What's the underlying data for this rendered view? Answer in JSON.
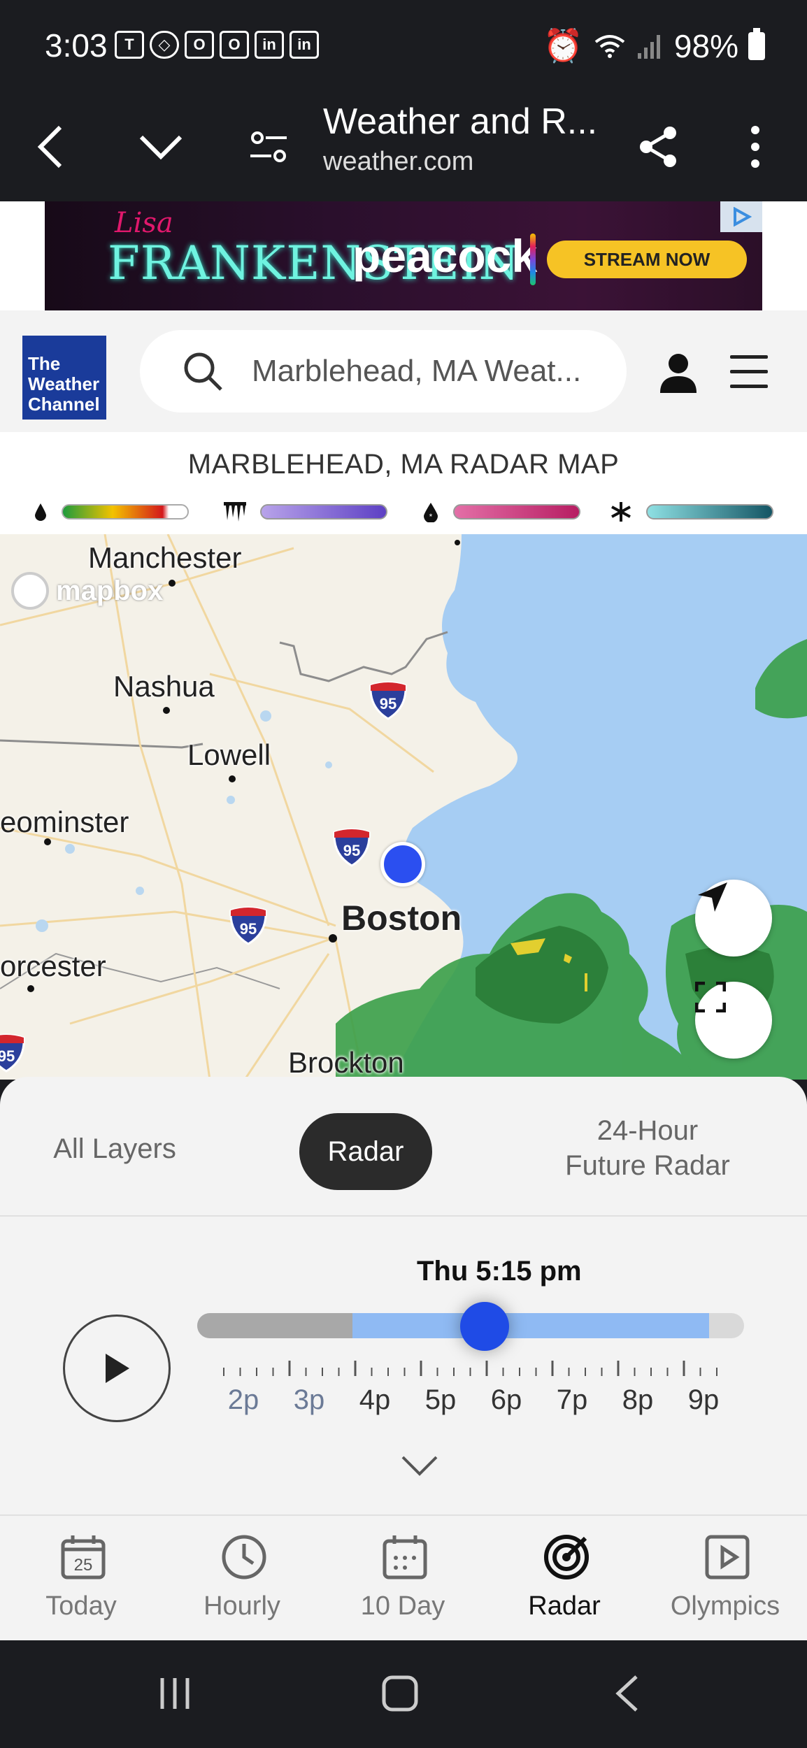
{
  "status_bar": {
    "time": "3:03",
    "battery": "98%",
    "left_icons": [
      "teams-icon",
      "copilot-icon",
      "office-icon",
      "outlook-icon",
      "linkedin-icon",
      "linkedin-icon"
    ],
    "right_icons": [
      "alarm-icon",
      "wifi-icon",
      "signal-icon",
      "battery-icon"
    ]
  },
  "browser": {
    "title": "Weather and R...",
    "url": "weather.com"
  },
  "ad": {
    "script_text": "Lisa",
    "title": "FRANKENSTEIN",
    "brand": "peacock",
    "cta": "STREAM NOW"
  },
  "header": {
    "logo_text": [
      "The",
      "Weather",
      "Channel"
    ],
    "search_placeholder": "Marblehead, MA Weat..."
  },
  "radar": {
    "title": "MARBLEHEAD, MA RADAR MAP",
    "legend": [
      {
        "icon": "rain-drop-icon",
        "gradient": [
          "#1e9b3c",
          "#f3c200",
          "#d3181b",
          "#ffffff"
        ]
      },
      {
        "icon": "ice-icon",
        "gradient": [
          "#b8a3ea",
          "#5d40c4"
        ]
      },
      {
        "icon": "mix-icon",
        "gradient": [
          "#e36fa7",
          "#b71d62"
        ]
      },
      {
        "icon": "snowflake-icon",
        "gradient": [
          "#8ee0e3",
          "#145564"
        ]
      }
    ]
  },
  "map": {
    "attribution": "mapbox",
    "labels": [
      "Manchester",
      "Nashua",
      "Lowell",
      "eominster",
      "Boston",
      "orcester",
      "Brockton"
    ],
    "highway": "95",
    "partial_highway": "95"
  },
  "layers": {
    "tabs": [
      "All Layers",
      "Radar",
      "24-Hour\nFuture Radar"
    ],
    "active": "Radar"
  },
  "timeline": {
    "current_time": "Thu 5:15 pm",
    "hours": [
      "2p",
      "3p",
      "4p",
      "5p",
      "6p",
      "7p",
      "8p",
      "9p"
    ],
    "progress_fraction": 0.56
  },
  "nav": {
    "items": [
      {
        "label": "Today",
        "icon": "calendar-day-icon",
        "badge": "25"
      },
      {
        "label": "Hourly",
        "icon": "clock-icon"
      },
      {
        "label": "10 Day",
        "icon": "calendar-icon"
      },
      {
        "label": "Radar",
        "icon": "radar-icon"
      },
      {
        "label": "Olympics",
        "icon": "play-icon"
      }
    ],
    "active": "Radar"
  },
  "colors": {
    "accent": "#1f4be6",
    "logo_blue": "#1a3b9a",
    "water": "#a6cdf3",
    "land": "#f4f1e8",
    "radar_green": "#3a9f48"
  }
}
